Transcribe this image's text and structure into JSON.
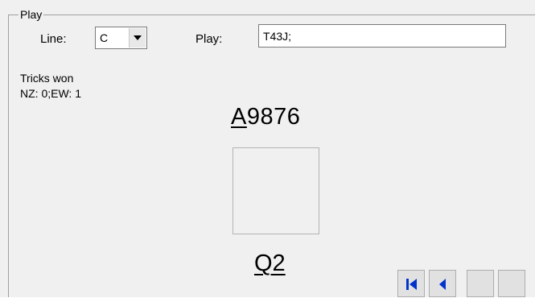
{
  "group": {
    "title": "Play"
  },
  "controls": {
    "line_label": "Line:",
    "line_value": "C",
    "play_label": "Play:",
    "play_value": "T43J;"
  },
  "tricks": {
    "title": "Tricks won",
    "score": "NZ: 0;EW: 1"
  },
  "hands": {
    "north_highlight": "A",
    "north_rest": "9876",
    "south": "Q2"
  },
  "navigation": {
    "first_icon": "skip-to-first-icon",
    "prev_icon": "step-back-icon",
    "icon_color": "#0033cc"
  }
}
